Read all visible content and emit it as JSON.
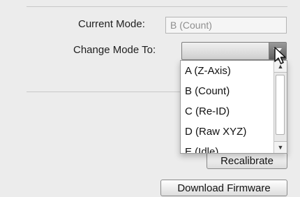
{
  "form": {
    "current_mode_label": "Current Mode:",
    "current_mode_value": "B (Count)",
    "change_mode_label": "Change Mode To:"
  },
  "select": {
    "selected_value": ""
  },
  "dropdown": {
    "options": [
      "A (Z-Axis)",
      "B (Count)",
      "C (Re-ID)",
      "D (Raw XYZ)",
      "E (Idle)"
    ]
  },
  "buttons": {
    "recalibrate": "Recalibrate",
    "download_firmware": "Download Firmware"
  },
  "icons": {
    "select_arrow": "triangle-down-icon",
    "cursor": "arrow-cursor-icon"
  }
}
